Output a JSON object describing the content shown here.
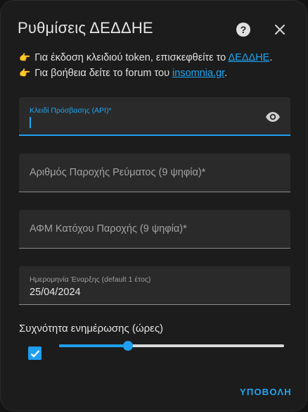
{
  "dialog": {
    "title": "Ρυθμίσεις ΔΕΔΔΗΕ",
    "help_icon": "question-circle-icon",
    "close_icon": "close-x-icon"
  },
  "info": {
    "line1_prefix": "Για έκδοση κλειδιού token, επισκεφθείτε το",
    "line1_link": "ΔΕΔΔΗΕ",
    "line1_suffix": ".",
    "line2_prefix": "Για βοήθεια δείτε το forum του",
    "line2_link": "insomnia.gr",
    "line2_suffix": ".",
    "bullet_icon": "pointing-hand-icon",
    "bullet_glyph": "👉"
  },
  "fields": {
    "api_key": {
      "label": "Κλειδί Πρόσβασης (API)*",
      "value": "",
      "eye_icon": "eye-icon"
    },
    "supply_number": {
      "label": "Αριθμός Παροχής Ρεύματος (9 ψηφία)*",
      "value": ""
    },
    "tax_id": {
      "label": "ΑΦΜ Κατόχου Παροχής (9 ψηφία)*",
      "value": ""
    },
    "start_date": {
      "label": "Ημερομηνία Έναρξης (default 1 έτος)",
      "value": "25/04/2024"
    }
  },
  "frequency": {
    "label": "Συχνότητα ενημέρωσης (ώρες)",
    "checkbox_checked": true,
    "slider_fraction": 0.306
  },
  "actions": {
    "submit_label": "ΥΠΟΒΟΛΗ"
  },
  "colors": {
    "accent": "#1e9ff0",
    "link": "#1ea7f5",
    "background": "#1c1c1c"
  }
}
